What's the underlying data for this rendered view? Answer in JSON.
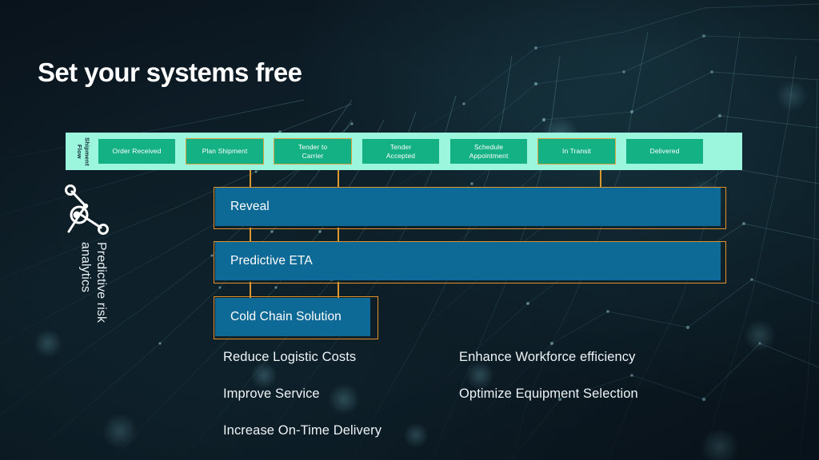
{
  "slide": {
    "title": "Set your systems free",
    "background_color": "#0c1822",
    "accent_orange": "#e2922a",
    "accent_teal": "#13b183",
    "band_teal": "#9cf5dd",
    "bar_blue": "#0d6995"
  },
  "flow": {
    "label": "Shipment\nFlow",
    "stages": [
      {
        "label": "Order Received",
        "highlighted": false
      },
      {
        "label": "Plan Shipment",
        "highlighted": true
      },
      {
        "label": "Tender to\nCarrier",
        "highlighted": true
      },
      {
        "label": "Tender\nAccepted",
        "highlighted": false
      },
      {
        "label": "Schedule\nAppointment",
        "highlighted": false
      },
      {
        "label": "In Transit",
        "highlighted": true
      },
      {
        "label": "Delivered",
        "highlighted": false
      }
    ]
  },
  "sidebar": {
    "icon": "network-nodes-icon",
    "label": "Predictive risk\nanalytics"
  },
  "solutions": [
    {
      "label": "Reveal"
    },
    {
      "label": "Predictive ETA"
    },
    {
      "label": "Cold Chain Solution"
    }
  ],
  "benefits": {
    "left": [
      "Reduce Logistic Costs",
      "Improve Service",
      "Increase On-Time Delivery"
    ],
    "right": [
      "Enhance Workforce efficiency",
      "Optimize Equipment Selection"
    ]
  }
}
